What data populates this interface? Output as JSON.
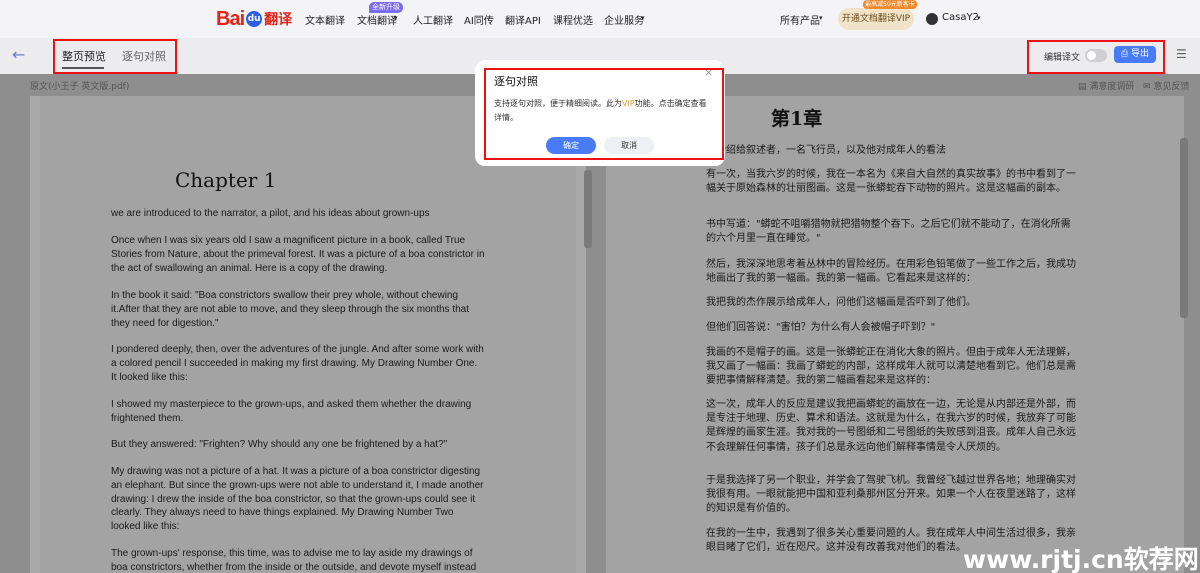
{
  "header": {
    "logo_text": "Bai",
    "logo_paw": "du",
    "logo_fanyi": "翻译",
    "nav": [
      "文本翻译",
      "文档翻译",
      "人工翻译",
      "AI同传",
      "翻译API",
      "课程优选",
      "企业服务"
    ],
    "new_badge": "全新升级",
    "all_products": "所有产品",
    "vip_button": "开通文档翻译VIP",
    "vip_tag": "最高减50元新客卡",
    "username": "CasaY2"
  },
  "subbar": {
    "tabs": [
      "整页预览",
      "逐句对照"
    ],
    "edit_label": "编辑译文",
    "export_label": "导出",
    "file_name": "原文(小王子 英文版.pdf)",
    "survey": "满意度调研",
    "feedback": "意见反馈"
  },
  "left_page": {
    "chapter": "Chapter 1",
    "paragraphs": [
      "we are introduced to the narrator, a pilot, and his ideas about grown-ups",
      "Once when I was six years old I saw a magnificent picture in a book, called True Stories from Nature, about the primeval forest. It was a picture of a boa constrictor in the act of swallowing an animal. Here is a copy of the drawing.",
      "In the book it said: \"Boa constrictors swallow their prey whole, without chewing it.After that they are not able to move, and they sleep through the six months that they need for digestion.\"",
      "I pondered deeply, then, over the adventures of the jungle. And after some work with a colored pencil I succeeded in making my first drawing. My Drawing Number One. It looked like this:",
      "I showed my masterpiece to the grown-ups, and asked them whether the drawing frightened them.",
      "But they answered: \"Frighten? Why should any one be frightened by a hat?\"",
      "My drawing was not a picture of a hat. It was a picture of a boa constrictor digesting an elephant. But since the grown-ups were not able to understand it, I made another drawing: I drew the inside of the boa constrictor, so that the grown-ups could see it clearly. They always need to have things explained. My Drawing Number Two looked like this:",
      "The grown-ups' response, this time, was to advise me to lay aside my drawings of boa constrictors, whether from the inside or the outside, and devote myself instead"
    ]
  },
  "right_page": {
    "chapter": "第1章",
    "paragraphs": [
      "被介绍给叙述者，一名飞行员，以及他对成年人的看法",
      "有一次，当我六岁的时候，我在一本名为《来自大自然的真实故事》的书中看到了一幅关于原始森林的壮丽图画。这是一张蟒蛇吞下动物的照片。这是这幅画的副本。",
      "书中写道：\"蟒蛇不咀嚼猎物就把猎物整个吞下。之后它们就不能动了，在消化所需的六个月里一直在睡觉。\"",
      "然后，我深深地思考着丛林中的冒险经历。在用彩色铅笔做了一些工作之后，我成功地画出了我的第一幅画。我的第一幅画。它看起来是这样的：",
      "我把我的杰作展示给成年人，问他们这幅画是否吓到了他们。",
      "但他们回答说：\"害怕？为什么有人会被帽子吓到？\"",
      "我画的不是帽子的画。这是一张蟒蛇正在消化大象的照片。但由于成年人无法理解，我又画了一幅画：我画了蟒蛇的内部，这样成年人就可以清楚地看到它。他们总是需要把事情解释清楚。我的第二幅画看起来是这样的：",
      "这一次，成年人的反应是建议我把画蟒蛇的画放在一边，无论是从内部还是外部，而是专注于地理、历史、算术和语法。这就是为什么，在我六岁的时候，我放弃了可能是辉煌的画家生涯。我对我的一号图纸和二号图纸的失败感到沮丧。成年人自己永远不会理解任何事情，孩子们总是永远向他们解释事情是令人厌烦的。",
      "于是我选择了另一个职业，并学会了驾驶飞机。我曾经飞越过世界各地；地理确实对我很有用。一眼就能把中国和亚利桑那州区分开来。如果一个人在夜里迷路了，这样的知识是有价值的。",
      "在我的一生中，我遇到了很多关心重要问题的人。我在成年人中间生活过很多，我亲眼目睹了它们，近在咫尺。这并没有改善我对他们的看法。"
    ]
  },
  "modal": {
    "title": "逐句对照",
    "body_pre": "支持逐句对照，便于精细阅读。此为",
    "body_vip": "VIP",
    "body_post": "功能。点击确定查看详情。",
    "ok": "确定",
    "cancel": "取消",
    "close": "×"
  },
  "watermark": "www.rjtj.cn软荐网"
}
